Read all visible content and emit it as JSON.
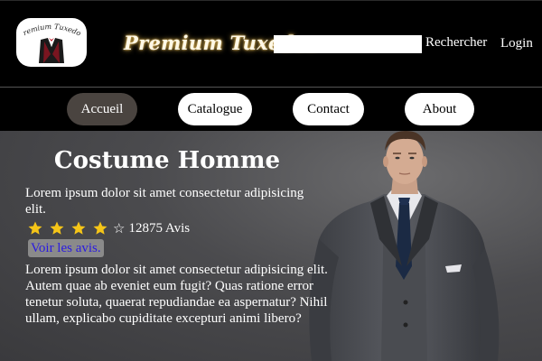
{
  "header": {
    "logo_text": "Premium Tuxedos",
    "brand": "Premium Tuxedos",
    "search": {
      "value": "",
      "placeholder": "",
      "button_label": "Rechercher"
    },
    "login_label": "Login"
  },
  "nav": {
    "items": [
      {
        "label": "Accueil",
        "active": true
      },
      {
        "label": "Catalogue",
        "active": false
      },
      {
        "label": "Contact",
        "active": false
      },
      {
        "label": "About",
        "active": false
      }
    ]
  },
  "hero": {
    "title": "Costume Homme",
    "intro": "Lorem ipsum dolor sit amet consectetur adipisicing elit.",
    "rating": {
      "stars_filled": 4,
      "stars_total": 5,
      "count_text": "12875 Avis"
    },
    "reviews_link": "Voir les avis.",
    "description": "Lorem ipsum dolor sit amet consectetur adipisicing elit. Autem quae ab eveniet eum fugit? Quas ratione error tenetur soluta, quaerat repudiandae ea aspernatur? Nihil ullam, explicabo cupiditate excepturi animi libero?"
  },
  "icons": {
    "star_filled": "star-icon",
    "star_empty": "star-outline-icon",
    "model_image": "man-in-suit-photo"
  },
  "colors": {
    "star": "#f5c518",
    "nav_active_bg": "#4a4440",
    "brand_glow": "#e9b94a",
    "link": "#2a1ae0"
  }
}
